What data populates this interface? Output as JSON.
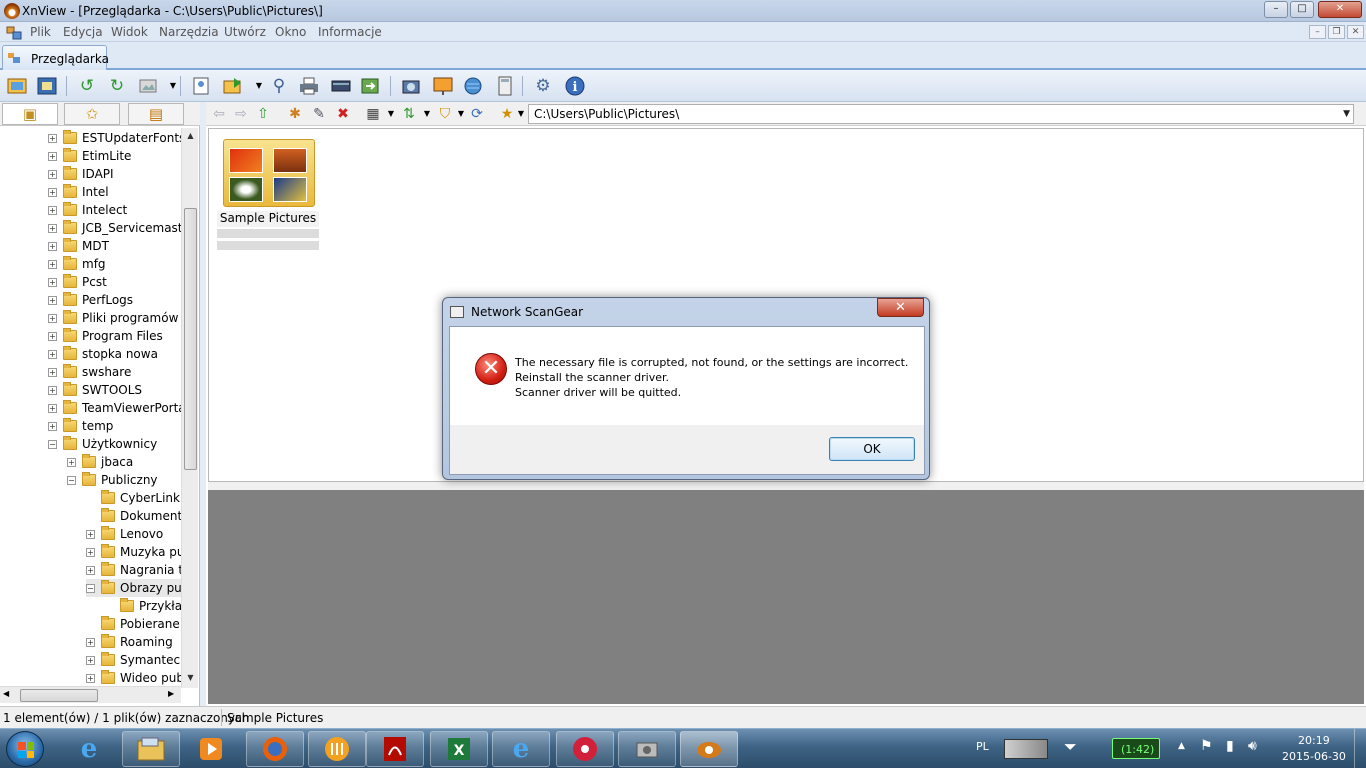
{
  "window": {
    "title": "XnView - [Przeglądarka - C:\\Users\\Public\\Pictures\\]",
    "min": "–",
    "max": "□",
    "close": "✕"
  },
  "menu": [
    "Plik",
    "Edycja",
    "Widok",
    "Narzędzia",
    "Utwórz",
    "Okno",
    "Informacje"
  ],
  "tab": {
    "label": "Przeglądarka"
  },
  "toolbar_icons": [
    "open-icon",
    "fullscreen-icon",
    "rotate-left-icon",
    "rotate-right-icon",
    "image-icon",
    "properties-icon",
    "export-icon",
    "binoculars-icon",
    "print-icon",
    "scanner-icon",
    "convert-icon",
    "capture-icon",
    "slideshow-icon",
    "web-icon",
    "calculator-icon",
    "settings-icon",
    "info-icon"
  ],
  "left_tabs": [
    "folders-tab",
    "favorites-tab",
    "catalog-tab"
  ],
  "tree": [
    {
      "label": "ESTUpdaterFonts",
      "depth": 0,
      "exp": "+"
    },
    {
      "label": "EtimLite",
      "depth": 0,
      "exp": "+"
    },
    {
      "label": "IDAPI",
      "depth": 0,
      "exp": "+"
    },
    {
      "label": "Intel",
      "depth": 0,
      "exp": "+"
    },
    {
      "label": "Intelect",
      "depth": 0,
      "exp": "+"
    },
    {
      "label": "JCB_Servicemaster",
      "depth": 0,
      "exp": "+"
    },
    {
      "label": "MDT",
      "depth": 0,
      "exp": "+"
    },
    {
      "label": "mfg",
      "depth": 0,
      "exp": "+"
    },
    {
      "label": "Pcst",
      "depth": 0,
      "exp": "+"
    },
    {
      "label": "PerfLogs",
      "depth": 0,
      "exp": "+"
    },
    {
      "label": "Pliki programów (x",
      "depth": 0,
      "exp": "+"
    },
    {
      "label": "Program Files",
      "depth": 0,
      "exp": "+"
    },
    {
      "label": "stopka nowa",
      "depth": 0,
      "exp": "+"
    },
    {
      "label": "swshare",
      "depth": 0,
      "exp": "+"
    },
    {
      "label": "SWTOOLS",
      "depth": 0,
      "exp": "+"
    },
    {
      "label": "TeamViewerPortal",
      "depth": 0,
      "exp": "+"
    },
    {
      "label": "temp",
      "depth": 0,
      "exp": "+"
    },
    {
      "label": "Użytkownicy",
      "depth": 0,
      "exp": "−"
    },
    {
      "label": "jbaca",
      "depth": 1,
      "exp": "+"
    },
    {
      "label": "Publiczny",
      "depth": 1,
      "exp": "−"
    },
    {
      "label": "CyberLink",
      "depth": 2,
      "exp": ""
    },
    {
      "label": "Dokumenty",
      "depth": 2,
      "exp": ""
    },
    {
      "label": "Lenovo",
      "depth": 2,
      "exp": "+"
    },
    {
      "label": "Muzyka pub",
      "depth": 2,
      "exp": "+"
    },
    {
      "label": "Nagrania tel",
      "depth": 2,
      "exp": "+"
    },
    {
      "label": "Obrazy pub",
      "depth": 2,
      "exp": "−"
    },
    {
      "label": "Przykłac",
      "depth": 3,
      "exp": ""
    },
    {
      "label": "Pobierane p",
      "depth": 2,
      "exp": ""
    },
    {
      "label": "Roaming",
      "depth": 2,
      "exp": "+"
    },
    {
      "label": "Symantec",
      "depth": 2,
      "exp": "+"
    },
    {
      "label": "Wideo pub",
      "depth": 2,
      "exp": "+"
    }
  ],
  "path": "C:\\Users\\Public\\Pictures\\",
  "files": [
    {
      "name": "Sample Pictures"
    }
  ],
  "status": {
    "selection": "1 element(ów) / 1 plik(ów) zaznaczonych",
    "current": "Sample Pictures"
  },
  "dialog": {
    "title": "Network ScanGear",
    "close": "✕",
    "error_glyph": "✕",
    "line1": "The necessary file is corrupted, not found, or the settings are incorrect.",
    "line2": "Reinstall the scanner driver.",
    "line3": "Scanner driver will be quitted.",
    "ok": "OK"
  },
  "taskbar": {
    "apps": [
      "ie-icon",
      "explorer-icon",
      "media-player-icon",
      "firefox-icon",
      "app-icon",
      "acrobat-icon",
      "excel-icon",
      "ie-icon",
      "remote-icon",
      "tool-icon",
      "xnview-icon"
    ],
    "lang": "PL",
    "battery_clock": "(1:42)",
    "time": "20:19",
    "date": "2015-06-30"
  },
  "colors": {
    "accent": "#7ea8d8",
    "error": "#d21f13",
    "preview_bg": "#808080"
  }
}
